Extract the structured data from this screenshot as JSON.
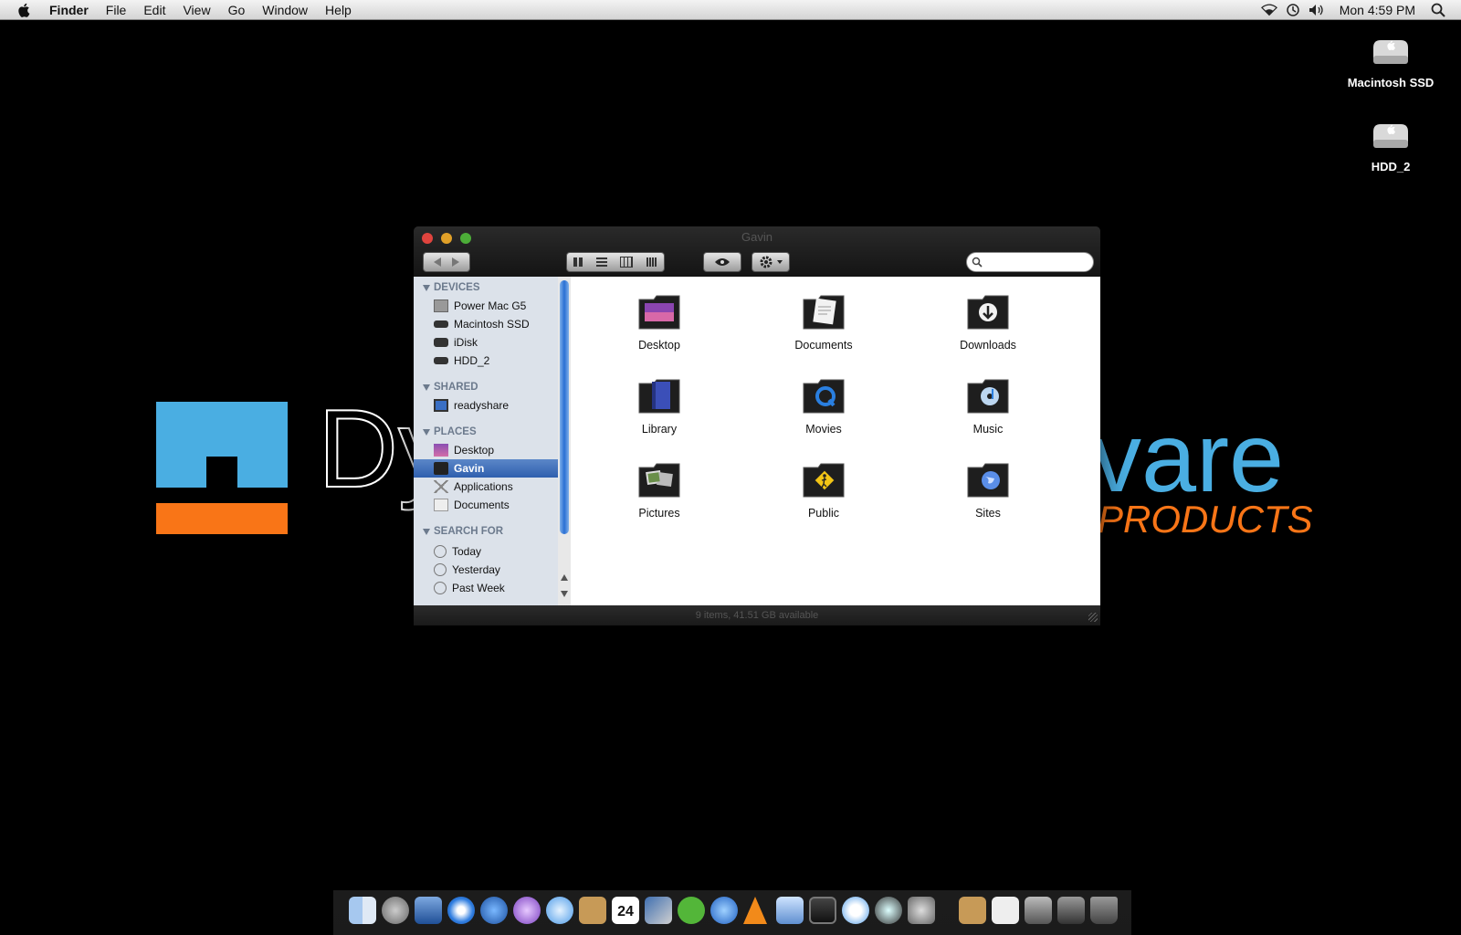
{
  "menubar": {
    "app": "Finder",
    "menus": [
      "File",
      "Edit",
      "View",
      "Go",
      "Window",
      "Help"
    ],
    "status_icons": [
      "wifi-icon",
      "time-machine-icon",
      "volume-icon"
    ],
    "clock": "Mon 4:59 PM"
  },
  "wallpaper": {
    "text_left": "Dy",
    "text_right": "vare",
    "subtitle": "PRODUCTS",
    "colors": {
      "blue": "#4aaee2",
      "orange": "#f97517"
    }
  },
  "desktop": {
    "drives": [
      {
        "label": "Macintosh SSD"
      },
      {
        "label": "HDD_2"
      }
    ]
  },
  "window": {
    "title": "Gavin",
    "status": "9 items, 41.51 GB available",
    "sidebar": {
      "devices_header": "DEVICES",
      "devices": [
        "Power Mac G5",
        "Macintosh SSD",
        "iDisk",
        "HDD_2"
      ],
      "shared_header": "SHARED",
      "shared": [
        "readyshare"
      ],
      "places_header": "PLACES",
      "places": [
        "Desktop",
        "Gavin",
        "Applications",
        "Documents"
      ],
      "search_header": "SEARCH FOR",
      "search": [
        "Today",
        "Yesterday",
        "Past Week"
      ],
      "selected": "Gavin"
    },
    "items": [
      "Desktop",
      "Documents",
      "Downloads",
      "Library",
      "Movies",
      "Music",
      "Pictures",
      "Public",
      "Sites"
    ]
  },
  "dock": {
    "apps": [
      "finder-icon",
      "launchpad-icon",
      "preview-icon",
      "safari-icon",
      "globe-icon",
      "podcast-icon",
      "messages-icon",
      "address-book-icon",
      "calendar-icon",
      "photos-icon",
      "spotify-icon",
      "itunes-icon",
      "vlc-icon",
      "windows-icon",
      "dashboard-icon",
      "airport-icon",
      "time-machine-icon",
      "system-preferences-icon",
      "mail-icon",
      "textedit-icon",
      "printer-icon",
      "network-icon",
      "trash-icon"
    ],
    "calendar_day": "24"
  }
}
